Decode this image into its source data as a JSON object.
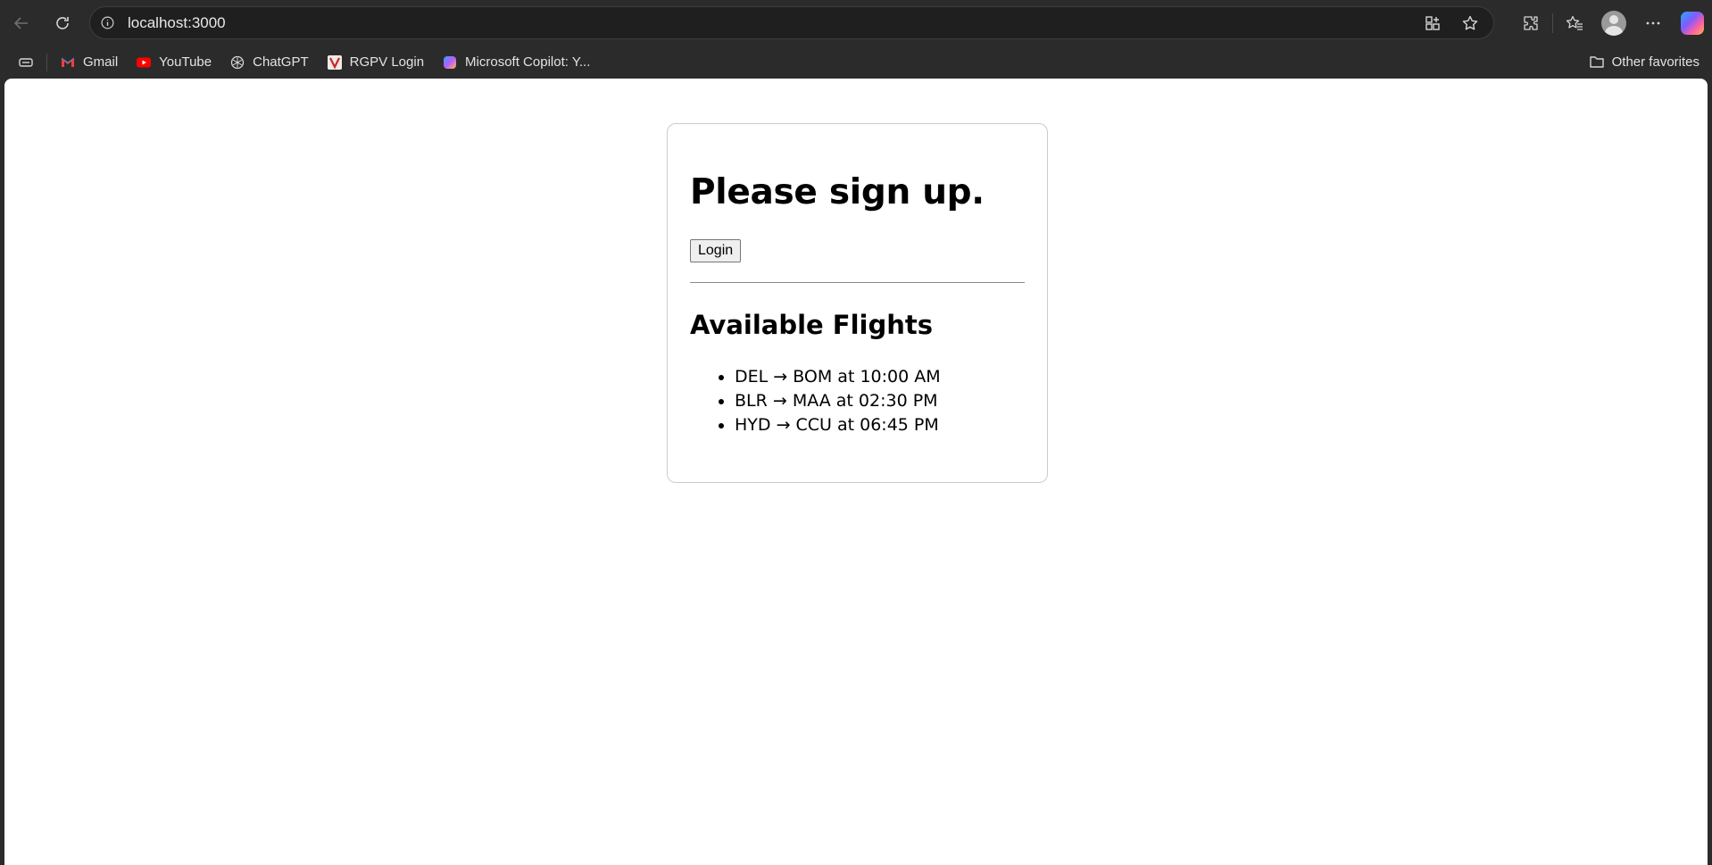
{
  "browser": {
    "url": "localhost:3000",
    "bookmarks": [
      {
        "label": "Gmail",
        "icon": "gmail-icon"
      },
      {
        "label": "YouTube",
        "icon": "youtube-icon"
      },
      {
        "label": "ChatGPT",
        "icon": "chatgpt-icon"
      },
      {
        "label": "RGPV Login",
        "icon": "rgpv-icon"
      },
      {
        "label": "Microsoft Copilot: Y...",
        "icon": "copilot-icon"
      }
    ],
    "other_favorites": "Other favorites",
    "colors": {
      "chrome_bg": "#2b2b2b",
      "address_bg": "#1f1f1f",
      "youtube_red": "#ff0000"
    }
  },
  "page": {
    "heading": "Please sign up.",
    "login_button": "Login",
    "flights_heading": "Available Flights",
    "flights": [
      "DEL → BOM at 10:00 AM",
      "BLR → MAA at 02:30 PM",
      "HYD → CCU at 06:45 PM"
    ]
  }
}
